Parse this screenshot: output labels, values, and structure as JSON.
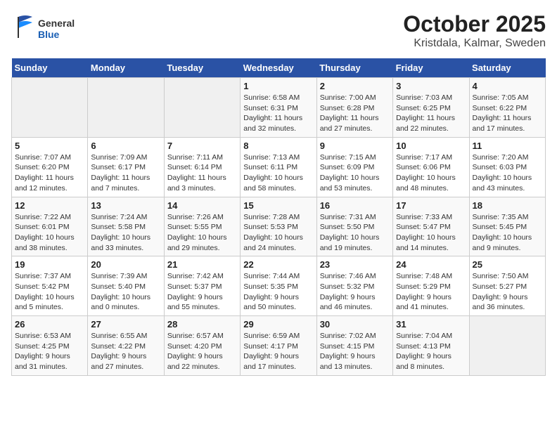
{
  "header": {
    "logo_general": "General",
    "logo_blue": "Blue",
    "title": "October 2025",
    "subtitle": "Kristdala, Kalmar, Sweden"
  },
  "weekdays": [
    "Sunday",
    "Monday",
    "Tuesday",
    "Wednesday",
    "Thursday",
    "Friday",
    "Saturday"
  ],
  "weeks": [
    [
      {
        "day": "",
        "info": ""
      },
      {
        "day": "",
        "info": ""
      },
      {
        "day": "",
        "info": ""
      },
      {
        "day": "1",
        "info": "Sunrise: 6:58 AM\nSunset: 6:31 PM\nDaylight: 11 hours\nand 32 minutes."
      },
      {
        "day": "2",
        "info": "Sunrise: 7:00 AM\nSunset: 6:28 PM\nDaylight: 11 hours\nand 27 minutes."
      },
      {
        "day": "3",
        "info": "Sunrise: 7:03 AM\nSunset: 6:25 PM\nDaylight: 11 hours\nand 22 minutes."
      },
      {
        "day": "4",
        "info": "Sunrise: 7:05 AM\nSunset: 6:22 PM\nDaylight: 11 hours\nand 17 minutes."
      }
    ],
    [
      {
        "day": "5",
        "info": "Sunrise: 7:07 AM\nSunset: 6:20 PM\nDaylight: 11 hours\nand 12 minutes."
      },
      {
        "day": "6",
        "info": "Sunrise: 7:09 AM\nSunset: 6:17 PM\nDaylight: 11 hours\nand 7 minutes."
      },
      {
        "day": "7",
        "info": "Sunrise: 7:11 AM\nSunset: 6:14 PM\nDaylight: 11 hours\nand 3 minutes."
      },
      {
        "day": "8",
        "info": "Sunrise: 7:13 AM\nSunset: 6:11 PM\nDaylight: 10 hours\nand 58 minutes."
      },
      {
        "day": "9",
        "info": "Sunrise: 7:15 AM\nSunset: 6:09 PM\nDaylight: 10 hours\nand 53 minutes."
      },
      {
        "day": "10",
        "info": "Sunrise: 7:17 AM\nSunset: 6:06 PM\nDaylight: 10 hours\nand 48 minutes."
      },
      {
        "day": "11",
        "info": "Sunrise: 7:20 AM\nSunset: 6:03 PM\nDaylight: 10 hours\nand 43 minutes."
      }
    ],
    [
      {
        "day": "12",
        "info": "Sunrise: 7:22 AM\nSunset: 6:01 PM\nDaylight: 10 hours\nand 38 minutes."
      },
      {
        "day": "13",
        "info": "Sunrise: 7:24 AM\nSunset: 5:58 PM\nDaylight: 10 hours\nand 33 minutes."
      },
      {
        "day": "14",
        "info": "Sunrise: 7:26 AM\nSunset: 5:55 PM\nDaylight: 10 hours\nand 29 minutes."
      },
      {
        "day": "15",
        "info": "Sunrise: 7:28 AM\nSunset: 5:53 PM\nDaylight: 10 hours\nand 24 minutes."
      },
      {
        "day": "16",
        "info": "Sunrise: 7:31 AM\nSunset: 5:50 PM\nDaylight: 10 hours\nand 19 minutes."
      },
      {
        "day": "17",
        "info": "Sunrise: 7:33 AM\nSunset: 5:47 PM\nDaylight: 10 hours\nand 14 minutes."
      },
      {
        "day": "18",
        "info": "Sunrise: 7:35 AM\nSunset: 5:45 PM\nDaylight: 10 hours\nand 9 minutes."
      }
    ],
    [
      {
        "day": "19",
        "info": "Sunrise: 7:37 AM\nSunset: 5:42 PM\nDaylight: 10 hours\nand 5 minutes."
      },
      {
        "day": "20",
        "info": "Sunrise: 7:39 AM\nSunset: 5:40 PM\nDaylight: 10 hours\nand 0 minutes."
      },
      {
        "day": "21",
        "info": "Sunrise: 7:42 AM\nSunset: 5:37 PM\nDaylight: 9 hours\nand 55 minutes."
      },
      {
        "day": "22",
        "info": "Sunrise: 7:44 AM\nSunset: 5:35 PM\nDaylight: 9 hours\nand 50 minutes."
      },
      {
        "day": "23",
        "info": "Sunrise: 7:46 AM\nSunset: 5:32 PM\nDaylight: 9 hours\nand 46 minutes."
      },
      {
        "day": "24",
        "info": "Sunrise: 7:48 AM\nSunset: 5:29 PM\nDaylight: 9 hours\nand 41 minutes."
      },
      {
        "day": "25",
        "info": "Sunrise: 7:50 AM\nSunset: 5:27 PM\nDaylight: 9 hours\nand 36 minutes."
      }
    ],
    [
      {
        "day": "26",
        "info": "Sunrise: 6:53 AM\nSunset: 4:25 PM\nDaylight: 9 hours\nand 31 minutes."
      },
      {
        "day": "27",
        "info": "Sunrise: 6:55 AM\nSunset: 4:22 PM\nDaylight: 9 hours\nand 27 minutes."
      },
      {
        "day": "28",
        "info": "Sunrise: 6:57 AM\nSunset: 4:20 PM\nDaylight: 9 hours\nand 22 minutes."
      },
      {
        "day": "29",
        "info": "Sunrise: 6:59 AM\nSunset: 4:17 PM\nDaylight: 9 hours\nand 17 minutes."
      },
      {
        "day": "30",
        "info": "Sunrise: 7:02 AM\nSunset: 4:15 PM\nDaylight: 9 hours\nand 13 minutes."
      },
      {
        "day": "31",
        "info": "Sunrise: 7:04 AM\nSunset: 4:13 PM\nDaylight: 9 hours\nand 8 minutes."
      },
      {
        "day": "",
        "info": ""
      }
    ]
  ]
}
